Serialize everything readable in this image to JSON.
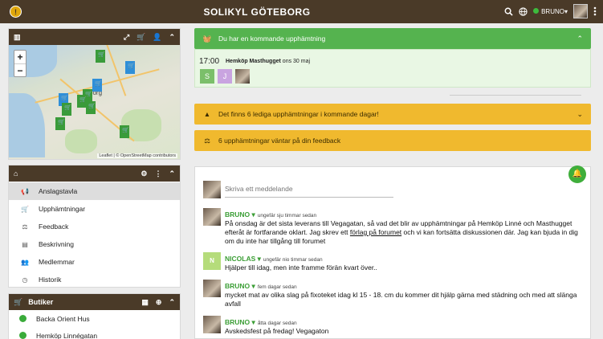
{
  "header": {
    "logo_glyph": "!",
    "title": "SOLIKYL GÖTEBORG",
    "user_name": "BRUNO",
    "user_caret": "▾"
  },
  "map_panel": {
    "zoom_in": "+",
    "zoom_out": "−",
    "city_label": "borg",
    "attribution": "Leaflet | © OpenStreetMap contributors"
  },
  "nav": {
    "items": [
      {
        "label": "Anslagstavla",
        "icon": "megaphone-icon",
        "glyph": "📢"
      },
      {
        "label": "Upphämtningar",
        "icon": "cart-icon",
        "glyph": "🛒"
      },
      {
        "label": "Feedback",
        "icon": "scale-icon",
        "glyph": "⚖"
      },
      {
        "label": "Beskrivning",
        "icon": "card-icon",
        "glyph": "▤"
      },
      {
        "label": "Medlemmar",
        "icon": "users-icon",
        "glyph": "👥"
      },
      {
        "label": "Historik",
        "icon": "clock-icon",
        "glyph": "◷"
      }
    ]
  },
  "stores": {
    "title": "Butiker",
    "items": [
      "Backa Orient Hus",
      "Hemköp Linnégatan"
    ]
  },
  "alerts": {
    "upcoming": "Du har en kommande upphämtning",
    "free_slots": "Det finns 6 lediga upphämtningar i kommande dagar!",
    "feedback": "6 upphämtningar väntar på din feedback"
  },
  "pickup": {
    "time": "17:00",
    "store": "Hemköp Masthugget",
    "date": "ons 30 maj",
    "avatars": [
      {
        "letter": "S",
        "color": "#7bbf6a"
      },
      {
        "letter": "J",
        "color": "#c9a4e0"
      }
    ]
  },
  "feed": {
    "placeholder": "Skriva ett meddelande",
    "posts": [
      {
        "author": "BRUNO",
        "when": "ungefär sju timmar sedan",
        "text_before": "På onsdag är det sista leverans till Vegagatan, så vad det blir av upphämtningar på Hemköp Linné och Masthugget efteråt är fortfarande oklart. Jag skrev ett ",
        "link": "förlag på forumet",
        "text_after": " och vi kan fortsätta diskussionen där. Jag kan bjuda in dig om du inte har tillgång till forumet"
      },
      {
        "author": "NICOLAS",
        "when": "ungefär nio timmar sedan",
        "text": "Hjälper till idag, men inte framme förän kvart över.."
      },
      {
        "author": "BRUNO",
        "when": "fem dagar sedan",
        "text": "mycket mat av olika slag på fixoteket idag kl 15 - 18. cm du kommer dit hjälp gärna med städning och med att slänga avfall"
      },
      {
        "author": "BRUNO",
        "when": "åtta dagar sedan",
        "text": "Avskedsfest på fredag! Vegagaton"
      }
    ]
  },
  "colors": {
    "brand_brown": "#4a3a28",
    "success_green": "#55b34f",
    "warning_yellow": "#f0b92e"
  }
}
